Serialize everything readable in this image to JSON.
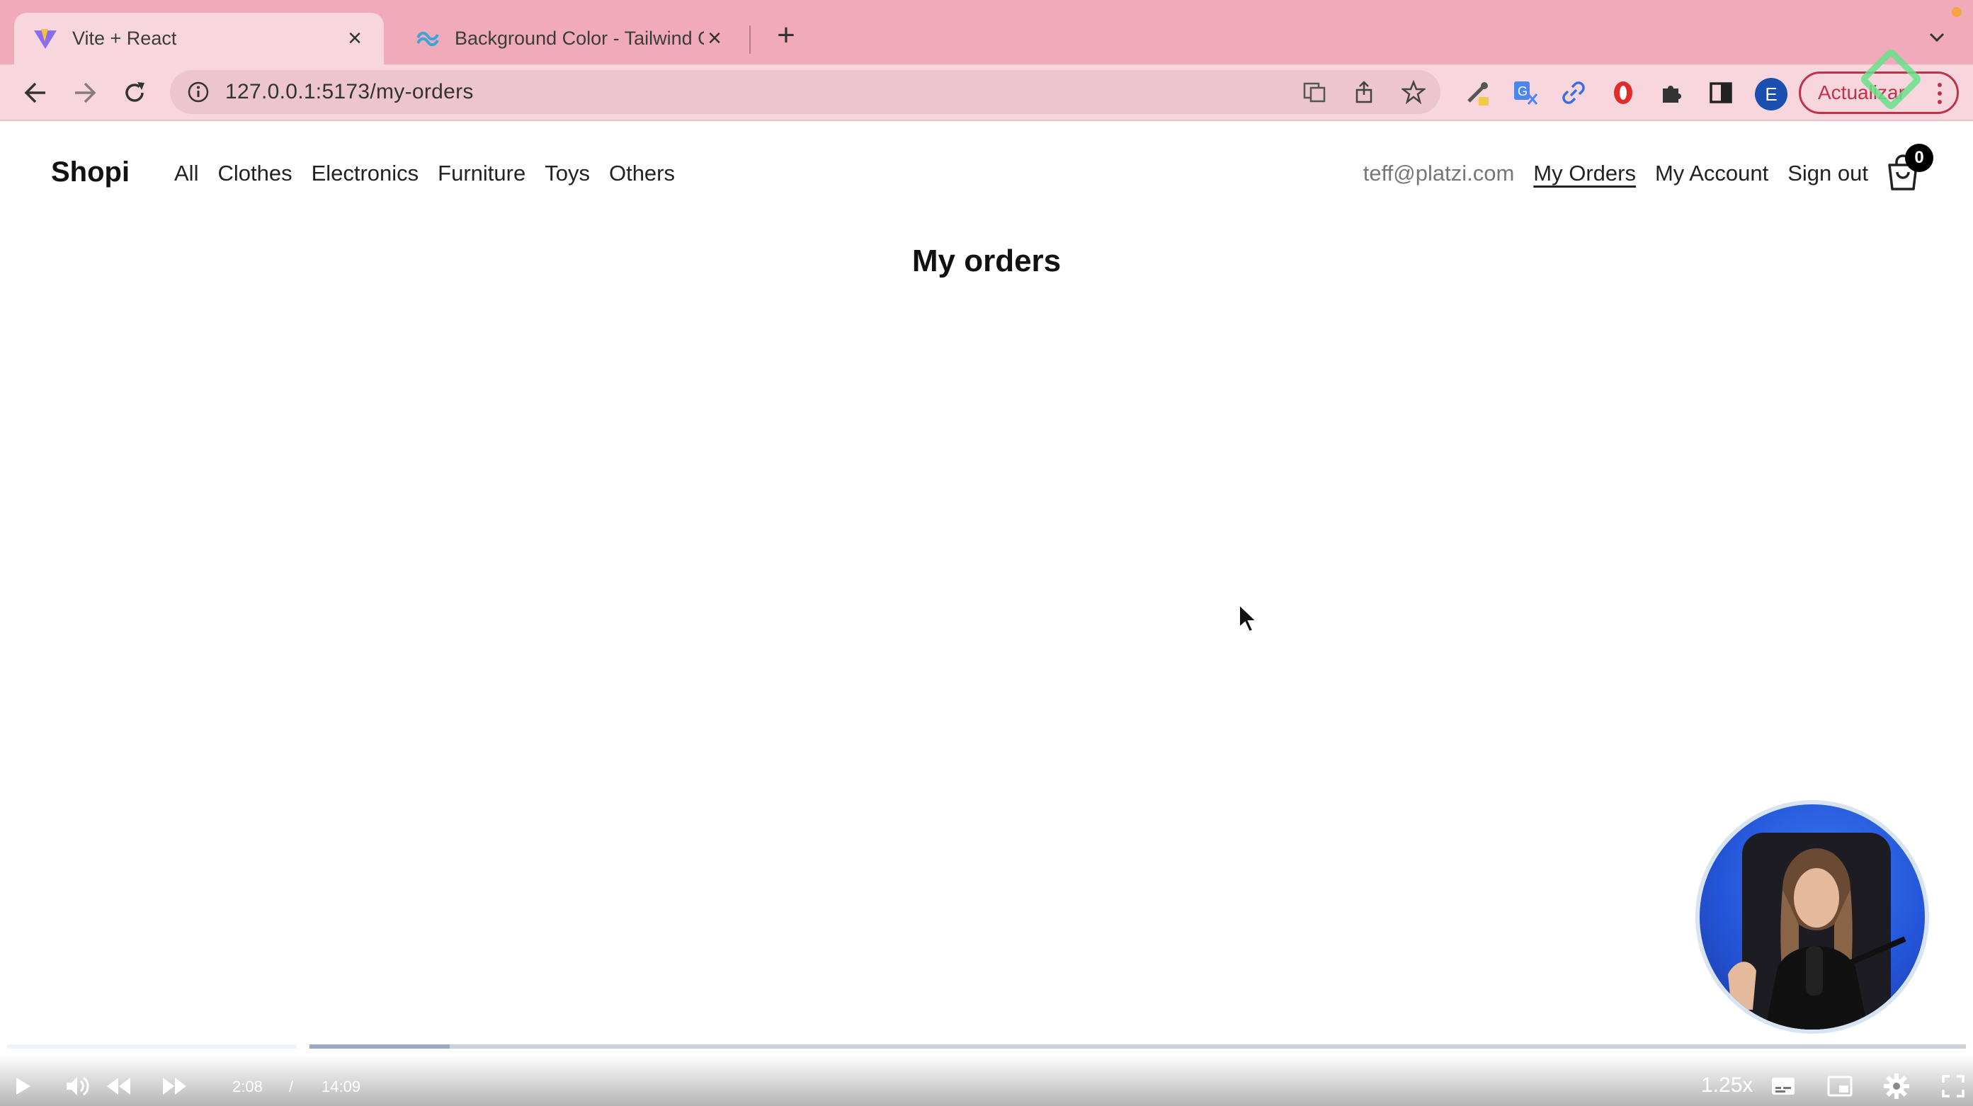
{
  "browser": {
    "tabs": [
      {
        "title": "Vite + React",
        "active": true
      },
      {
        "title": "Background Color - Tailwind CSS",
        "active": false
      }
    ],
    "new_tab_symbol": "+",
    "close_symbol": "×",
    "url": "127.0.0.1:5173/my-orders",
    "profile_initial": "E",
    "update_label": "Actualizar",
    "accent_color": "#f1aab9"
  },
  "app": {
    "brand": "Shopi",
    "categories": [
      "All",
      "Clothes",
      "Electronics",
      "Furniture",
      "Toys",
      "Others"
    ],
    "user_email": "teff@platzi.com",
    "links": {
      "my_orders": "My Orders",
      "my_account": "My Account",
      "sign_out": "Sign out"
    },
    "cart_count": "0",
    "page_title": "My orders"
  },
  "video": {
    "current_time": "2:08",
    "separator": "/",
    "duration": "14:09",
    "progress_fraction": 0.151,
    "speed": "1.25x"
  }
}
